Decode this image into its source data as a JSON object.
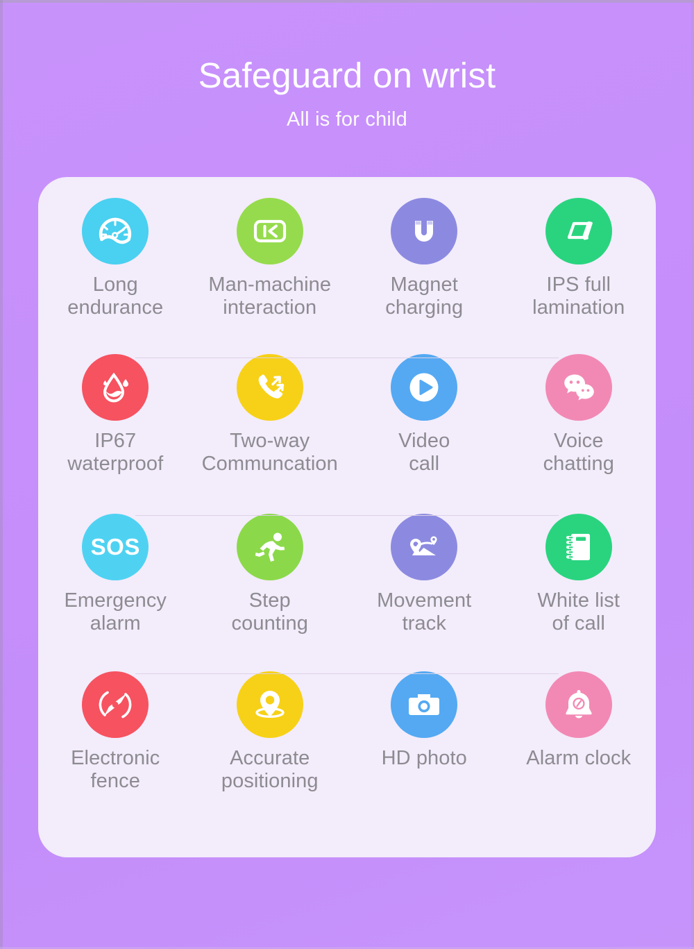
{
  "header": {
    "title": "Safeguard on wrist",
    "subtitle": "All is for child"
  },
  "colors": {
    "page_background_start": "#c892fb",
    "page_background_end": "#c693fb",
    "card_background": "#f3ecfb",
    "label_text": "#8d8b91",
    "divider": "#dcd2e6",
    "title_text": "#ffffff"
  },
  "features": [
    [
      {
        "label": "Long\nendurance",
        "icon": "speedometer-icon",
        "circle_color": "#4ad0f0"
      },
      {
        "label": "Man-machine\ninteraction",
        "icon": "screen-skip-back-icon",
        "circle_color": "#96db4d"
      },
      {
        "label": "Magnet\ncharging",
        "icon": "magnet-icon",
        "circle_color": "#8c8ae0"
      },
      {
        "label": "IPS full\nlamination",
        "icon": "layers-parallelogram-icon",
        "circle_color": "#2ad47f"
      }
    ],
    [
      {
        "label": "IP67\nwaterproof",
        "icon": "water-drop-icon",
        "circle_color": "#f65260"
      },
      {
        "label": "Two-way\nCommuncation",
        "icon": "phone-two-way-icon",
        "circle_color": "#f7d117"
      },
      {
        "label": "Video\ncall",
        "icon": "play-circle-icon",
        "circle_color": "#54a9f2"
      },
      {
        "label": "Voice\nchatting",
        "icon": "chat-bubbles-icon",
        "circle_color": "#f289b4"
      }
    ],
    [
      {
        "label": "Emergency\nalarm",
        "icon": "sos-icon",
        "circle_color": "#4fd2f2"
      },
      {
        "label": "Step\ncounting",
        "icon": "running-person-icon",
        "circle_color": "#8bd94a"
      },
      {
        "label": "Movement\ntrack",
        "icon": "map-route-icon",
        "circle_color": "#8c8ae0"
      },
      {
        "label": "White list\nof call",
        "icon": "notebook-icon",
        "circle_color": "#2ad47f"
      }
    ],
    [
      {
        "label": "Electronic\nfence",
        "icon": "compass-icon",
        "circle_color": "#f65260"
      },
      {
        "label": "Accurate\npositioning",
        "icon": "location-pin-icon",
        "circle_color": "#f7d117"
      },
      {
        "label": "HD photo",
        "icon": "camera-icon",
        "circle_color": "#54a9f2"
      },
      {
        "label": "Alarm clock",
        "icon": "alarm-bell-icon",
        "circle_color": "#f289b4"
      }
    ]
  ],
  "sos_text": "SOS"
}
